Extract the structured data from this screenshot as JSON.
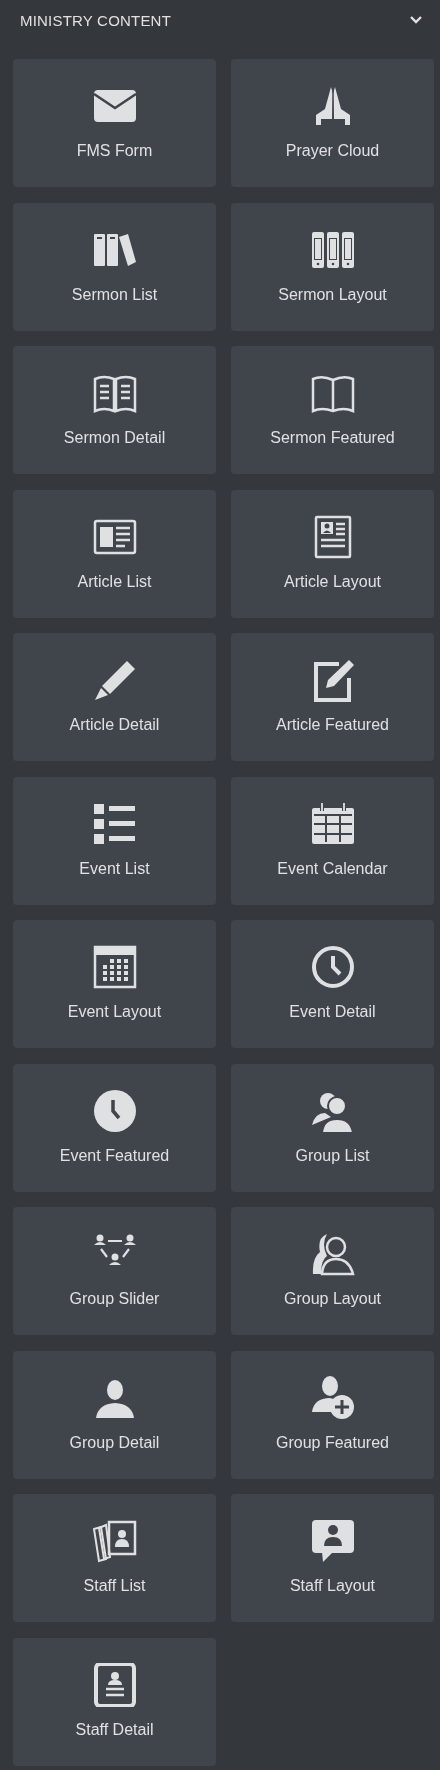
{
  "panel": {
    "title": "MINISTRY CONTENT",
    "expanded": true
  },
  "widgets": [
    {
      "label": "FMS Form"
    },
    {
      "label": "Prayer Cloud"
    },
    {
      "label": "Sermon List"
    },
    {
      "label": "Sermon Layout"
    },
    {
      "label": "Sermon Detail"
    },
    {
      "label": "Sermon Featured"
    },
    {
      "label": "Article List"
    },
    {
      "label": "Article Layout"
    },
    {
      "label": "Article Detail"
    },
    {
      "label": "Article Featured"
    },
    {
      "label": "Event List"
    },
    {
      "label": "Event Calendar"
    },
    {
      "label": "Event Layout"
    },
    {
      "label": "Event Detail"
    },
    {
      "label": "Event Featured"
    },
    {
      "label": "Group List"
    },
    {
      "label": "Group Slider"
    },
    {
      "label": "Group Layout"
    },
    {
      "label": "Group Detail"
    },
    {
      "label": "Group Featured"
    },
    {
      "label": "Staff List"
    },
    {
      "label": "Staff Layout"
    },
    {
      "label": "Staff Detail"
    }
  ]
}
